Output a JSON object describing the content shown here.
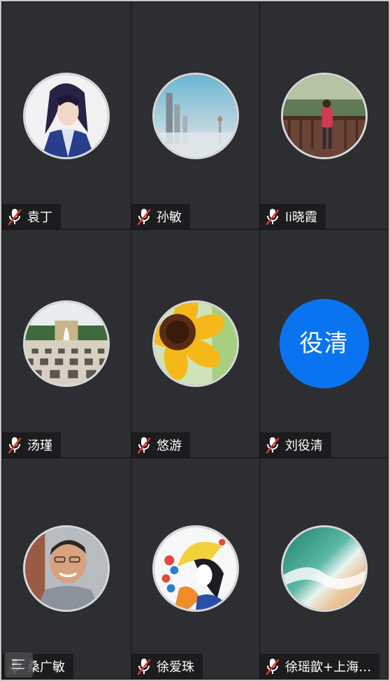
{
  "participants": [
    {
      "name": "袁丁",
      "avatar": "anime-warrior-avatar",
      "muted": true
    },
    {
      "name": "孙敏",
      "avatar": "city-skyline-avatar",
      "muted": true
    },
    {
      "name": "li晓霞",
      "avatar": "woman-on-bridge-avatar",
      "muted": true
    },
    {
      "name": "汤瑾",
      "avatar": "palace-garden-avatar",
      "muted": true
    },
    {
      "name": "悠游",
      "avatar": "sunflower-avatar",
      "muted": true
    },
    {
      "name": "刘役清",
      "avatar_text": "役清",
      "avatar_color": "#0a74f0",
      "muted": true
    },
    {
      "name": "桑广敏",
      "avatar": "man-portrait-avatar",
      "muted": true
    },
    {
      "name": "徐爱珠",
      "avatar": "illustration-girl-avatar",
      "muted": true
    },
    {
      "name": "徐瑶歆+上海…",
      "avatar": "beach-waves-avatar",
      "muted": true
    }
  ],
  "colors": {
    "tile_bg": "#2c2e31",
    "mic_muted": "#e0352b",
    "accent": "#0a74f0"
  },
  "icons": {
    "mic": "mic-muted-icon",
    "menu": "menu-icon"
  }
}
